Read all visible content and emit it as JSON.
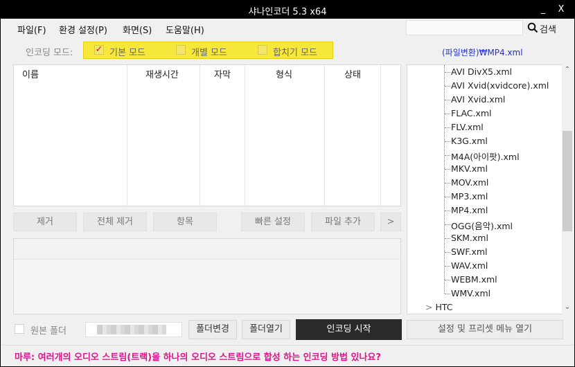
{
  "window": {
    "title": "샤나인코더  5.3  x64",
    "minimize": "_",
    "close": "X"
  },
  "menu": {
    "items": [
      {
        "label": "파일(F)"
      },
      {
        "label": "환경 설정(P)"
      },
      {
        "label": "화면(S)"
      },
      {
        "label": "도움말(H)"
      }
    ],
    "search_value": "",
    "search_label": "검색"
  },
  "mode": {
    "label": "인코딩 모드:",
    "options": [
      {
        "label": "기본 모드",
        "checked": true
      },
      {
        "label": "개별 모드",
        "checked": false
      },
      {
        "label": "합치기 모드",
        "checked": false
      }
    ]
  },
  "preset_path": "(파일변환)₩MP4.xml",
  "file_list": {
    "columns": [
      "이름",
      "재생시간",
      "자막",
      "형식",
      "상태"
    ]
  },
  "buttons": {
    "remove": "제거",
    "remove_all": "전체 제거",
    "item": "항목",
    "quick_settings": "빠른 설정",
    "add_file": "파일 추가",
    "more": ">"
  },
  "preset_tree": {
    "items": [
      "AVI DivX5.xml",
      "AVI Xvid(xvidcore).xml",
      "AVI Xvid.xml",
      "FLAC.xml",
      "FLV.xml",
      "K3G.xml",
      "M4A(아이팟).xml",
      "MKV.xml",
      "MOV.xml",
      "MP3.xml",
      "MP4.xml",
      "OGG(음악).xml",
      "SKM.xml",
      "SWF.xml",
      "WAV.xml",
      "WEBM.xml",
      "WMV.xml"
    ],
    "collapsed_node_arrow": ">",
    "collapsed_node": "HTC"
  },
  "bottom": {
    "source_folder_label": "원본 폴더",
    "source_folder_checked": false,
    "change_folder": "폴더변경",
    "open_folder": "폴더열기",
    "start_encoding": "인코딩 시작",
    "open_settings_menu": "설정 및 프리셋 메뉴 열기"
  },
  "status": {
    "message": "마루: 여러개의 오디오 스트림(트랙)을 하나의 오디오 스트림으로 합성 하는 인코딩  방법 있나요?"
  },
  "colors": {
    "titlebar": "#000000",
    "mode_highlight": "#f6e73a",
    "preset_link": "#2030d8",
    "status_text": "#e0148a",
    "encode_button": "#2a2a2a"
  }
}
